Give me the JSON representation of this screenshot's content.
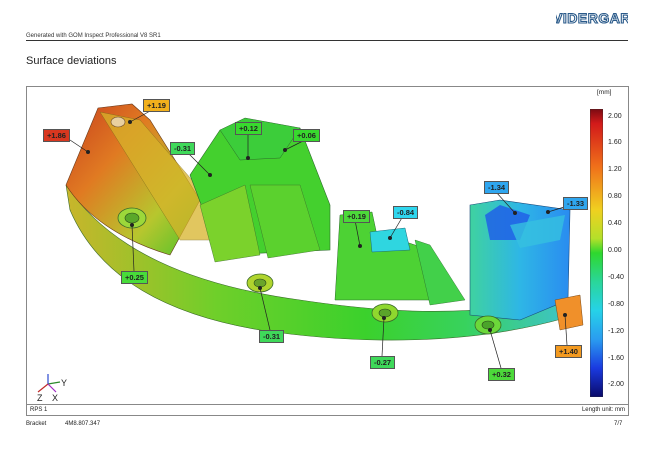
{
  "header": {
    "generator": "Generated with GOM Inspect Professional V8 SR1",
    "logo_text": "VIDERGAR"
  },
  "page_title": "Surface deviations",
  "scale": {
    "unit": "[mm]",
    "ticks": [
      "2.00",
      "1.60",
      "1.20",
      "0.80",
      "0.40",
      "0.00",
      "-0.40",
      "-0.80",
      "-1.20",
      "-1.60",
      "-2.00"
    ]
  },
  "callouts": [
    {
      "label": "+1.19",
      "color": "#f2b01c"
    },
    {
      "label": "+1.86",
      "color": "#d8371f"
    },
    {
      "label": "+0.12",
      "color": "#38d92e"
    },
    {
      "label": "+0.06",
      "color": "#38d92e"
    },
    {
      "label": "-0.31",
      "color": "#3fd95a"
    },
    {
      "label": "+0.19",
      "color": "#4cd93a"
    },
    {
      "label": "-0.84",
      "color": "#2fd6ee"
    },
    {
      "label": "-1.34",
      "color": "#2fa6ef"
    },
    {
      "label": "-1.33",
      "color": "#2fa6ef"
    },
    {
      "label": "+0.25",
      "color": "#48dc3a"
    },
    {
      "label": "-0.31",
      "color": "#3fd95a"
    },
    {
      "label": "-0.27",
      "color": "#3fd95a"
    },
    {
      "label": "+0.32",
      "color": "#4cd93a"
    },
    {
      "label": "+1.40",
      "color": "#f39a20"
    }
  ],
  "axes": {
    "x": "X",
    "y": "Y",
    "z": "Z"
  },
  "footer": {
    "left": "RPS 1",
    "right": "Length unit: mm",
    "part_name": "Bracket",
    "part_number": "4M8.807.347",
    "page": "7/7"
  }
}
